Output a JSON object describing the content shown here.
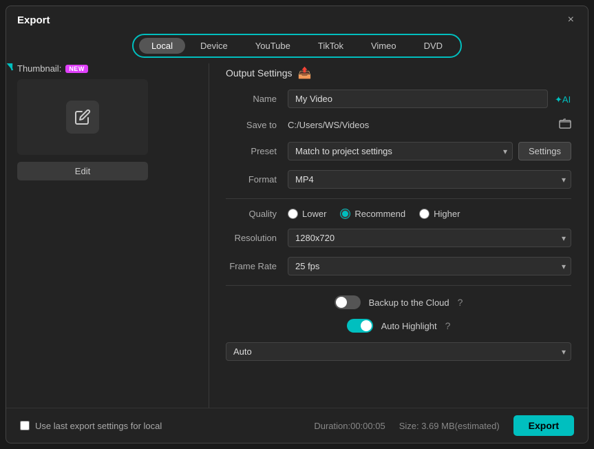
{
  "dialog": {
    "title": "Export",
    "close_label": "×"
  },
  "tabs": {
    "items": [
      {
        "label": "Local",
        "active": true
      },
      {
        "label": "Device",
        "active": false
      },
      {
        "label": "YouTube",
        "active": false
      },
      {
        "label": "TikTok",
        "active": false
      },
      {
        "label": "Vimeo",
        "active": false
      },
      {
        "label": "DVD",
        "active": false
      }
    ]
  },
  "left_panel": {
    "thumbnail_label": "Thumbnail:",
    "new_badge": "NEW",
    "edit_label": "Edit"
  },
  "output_settings": {
    "section_title": "Output Settings",
    "name_label": "Name",
    "name_value": "My Video",
    "save_to_label": "Save to",
    "save_to_value": "C:/Users/WS/Videos",
    "preset_label": "Preset",
    "preset_value": "Match to project settings",
    "settings_label": "Settings",
    "format_label": "Format",
    "format_value": "MP4",
    "quality_label": "Quality",
    "quality_options": [
      {
        "label": "Lower",
        "value": "lower",
        "checked": false
      },
      {
        "label": "Recommend",
        "value": "recommend",
        "checked": true
      },
      {
        "label": "Higher",
        "value": "higher",
        "checked": false
      }
    ],
    "resolution_label": "Resolution",
    "resolution_value": "1280x720",
    "frame_rate_label": "Frame Rate",
    "frame_rate_value": "25 fps",
    "backup_label": "Backup to the Cloud",
    "backup_enabled": false,
    "auto_highlight_label": "Auto Highlight",
    "auto_highlight_enabled": true,
    "auto_highlight_dropdown": "Auto"
  },
  "footer": {
    "checkbox_label": "Use last export settings for local",
    "duration_label": "Duration:00:00:05",
    "size_label": "Size: 3.69 MB(estimated)",
    "export_label": "Export"
  }
}
